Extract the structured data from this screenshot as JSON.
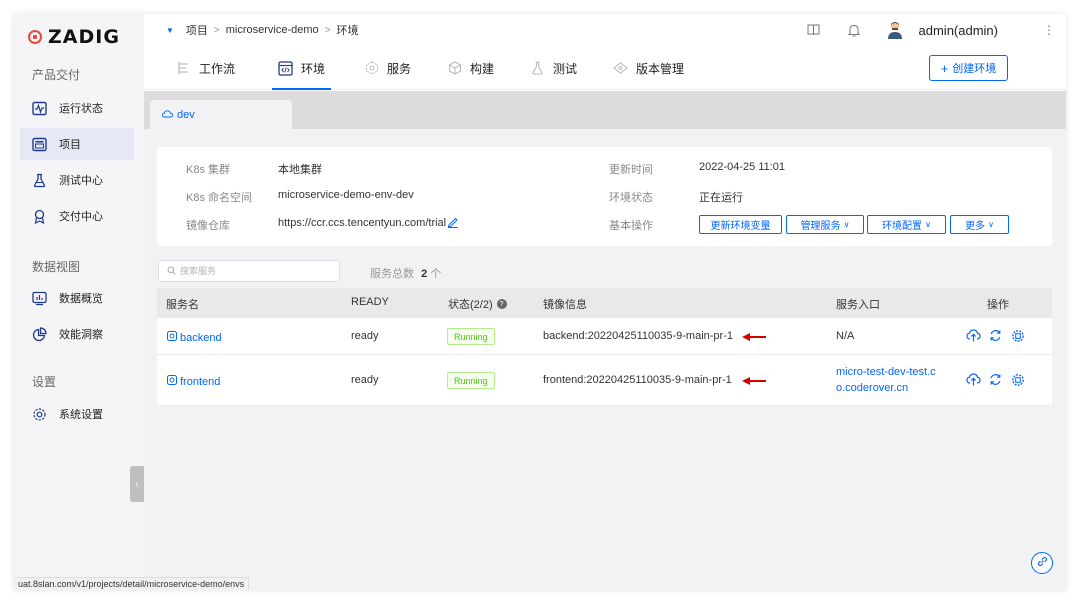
{
  "brand": {
    "name": "ZADIG",
    "color": "#e8473c"
  },
  "accent": "#0066ff",
  "sidebar": {
    "section_product": "产品交付",
    "section_data": "数据视图",
    "section_settings": "设置",
    "items": [
      {
        "label": "运行状态",
        "icon": "pulse-icon"
      },
      {
        "label": "项目",
        "icon": "project-icon",
        "active": true
      },
      {
        "label": "测试中心",
        "icon": "flask-icon"
      },
      {
        "label": "交付中心",
        "icon": "delivery-icon"
      },
      {
        "label": "数据概览",
        "icon": "chart-icon"
      },
      {
        "label": "效能洞察",
        "icon": "pie-icon"
      },
      {
        "label": "系统设置",
        "icon": "gear-icon"
      }
    ]
  },
  "breadcrumb": {
    "root": "项目",
    "project": "microservice-demo",
    "page": "环境"
  },
  "header": {
    "user": "admin(admin)"
  },
  "tabs": [
    {
      "label": "工作流",
      "icon": "workflow-icon"
    },
    {
      "label": "环境",
      "icon": "env-icon",
      "active": true
    },
    {
      "label": "服务",
      "icon": "service-icon"
    },
    {
      "label": "构建",
      "icon": "build-icon"
    },
    {
      "label": "测试",
      "icon": "test-icon"
    },
    {
      "label": "版本管理",
      "icon": "version-icon"
    }
  ],
  "create_env_label": "创建环境",
  "env_tab": {
    "name": "dev"
  },
  "info": {
    "cluster_label": "K8s 集群",
    "cluster_value": "本地集群",
    "namespace_label": "K8s 命名空间",
    "namespace_value": "microservice-demo-env-dev",
    "registry_label": "镜像仓库",
    "registry_value": "https://ccr.ccs.tencentyun.com/trial",
    "updated_label": "更新时间",
    "updated_value": "2022-04-25 11:01",
    "status_label": "环境状态",
    "status_value": "正在运行",
    "ops_label": "基本操作",
    "btn_update_vars": "更新环境变量",
    "btn_manage_services": "管理服务",
    "btn_env_config": "环境配置",
    "btn_more": "更多"
  },
  "search": {
    "placeholder": "搜索服务"
  },
  "service_count": {
    "label": "服务总数",
    "value": "2",
    "unit": "个"
  },
  "table": {
    "headers": {
      "name": "服务名",
      "ready": "READY",
      "status": "状态(2/2)",
      "image": "镜像信息",
      "entry": "服务入口",
      "ops": "操作"
    },
    "rows": [
      {
        "name": "backend",
        "ready": "ready",
        "status": "Running",
        "image": "backend:20220425110035-9-main-pr-1",
        "entry": "N/A"
      },
      {
        "name": "frontend",
        "ready": "ready",
        "status": "Running",
        "image": "frontend:20220425110035-9-main-pr-1",
        "entry_line1": "micro-test-dev-test.c",
        "entry_line2": "o.coderover.cn"
      }
    ]
  },
  "status_url": "uat.8slan.com/v1/projects/detail/microservice-demo/envs"
}
